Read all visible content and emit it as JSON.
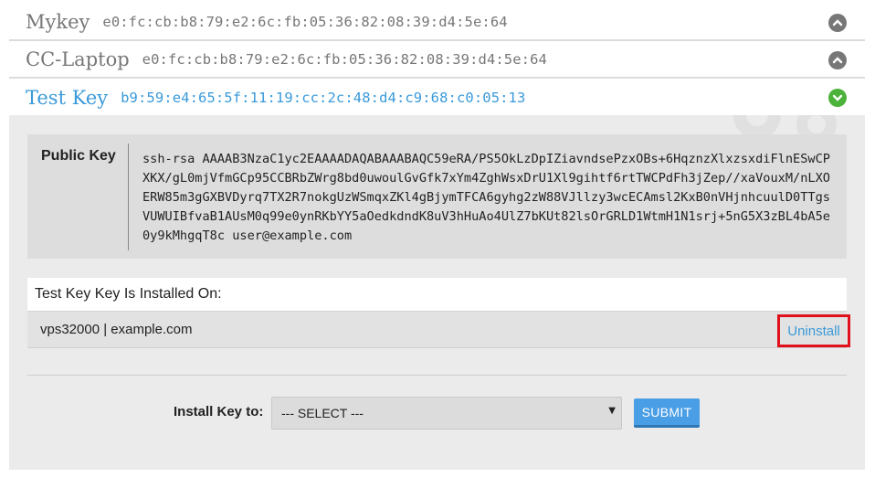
{
  "keys": [
    {
      "name": "Mykey",
      "fingerprint": "e0:fc:cb:b8:79:e2:6c:fb:05:36:82:08:39:d4:5e:64",
      "state": "collapsed"
    },
    {
      "name": "CC-Laptop",
      "fingerprint": "e0:fc:cb:b8:79:e2:6c:fb:05:36:82:08:39:d4:5e:64",
      "state": "collapsed"
    },
    {
      "name": "Test Key",
      "fingerprint": "b9:59:e4:65:5f:11:19:cc:2c:48:d4:c9:68:c0:05:13",
      "state": "expanded"
    }
  ],
  "detail": {
    "public_key_label": "Public Key",
    "public_key": "ssh-rsa AAAAB3NzaC1yc2EAAAADAQABAAABAQC59eRA/PS5OkLzDpIZiavndsePzxOBs+6HqznzXlxzsxdiFlnESwCPXKX/gL0mjVfmGCp95CCBRbZWrg8bd0uwoulGvGfk7xYm4ZghWsxDrU1Xl9gihtf6rtTWCPdFh3jZep//xaVouxM/nLXOERW85m3gGXBVDyrq7TX2R7nokgUzWSmqxZKl4gBjymTFCA6gyhg2zW88VJllzy3wcECAmsl2KxB0nVHjnhcuulD0TTgsVUWUIBfvaB1AUsM0q99e0ynRKbYY5aOedkdndK8uV3hHuAo4UlZ7bKUt82lsOrGRLD1WtmH1N1srj+5nG5X3zBL4bA5e0y9kMhgqT8c user@example.com",
    "installed_header": "Test Key Key Is Installed On:",
    "installed_on": [
      {
        "server": "vps32000 | example.com",
        "action": "Uninstall"
      }
    ],
    "install_label": "Install Key to:",
    "select_value": "--- SELECT ---",
    "submit_label": "SUBMIT"
  },
  "colors": {
    "accent": "#3a9ad9",
    "success": "#4cb33a",
    "highlight": "#e0101c"
  },
  "icons": {
    "collapsed": "chevron-up-icon",
    "expanded": "chevron-down-icon",
    "decoration": "gear-icon"
  }
}
